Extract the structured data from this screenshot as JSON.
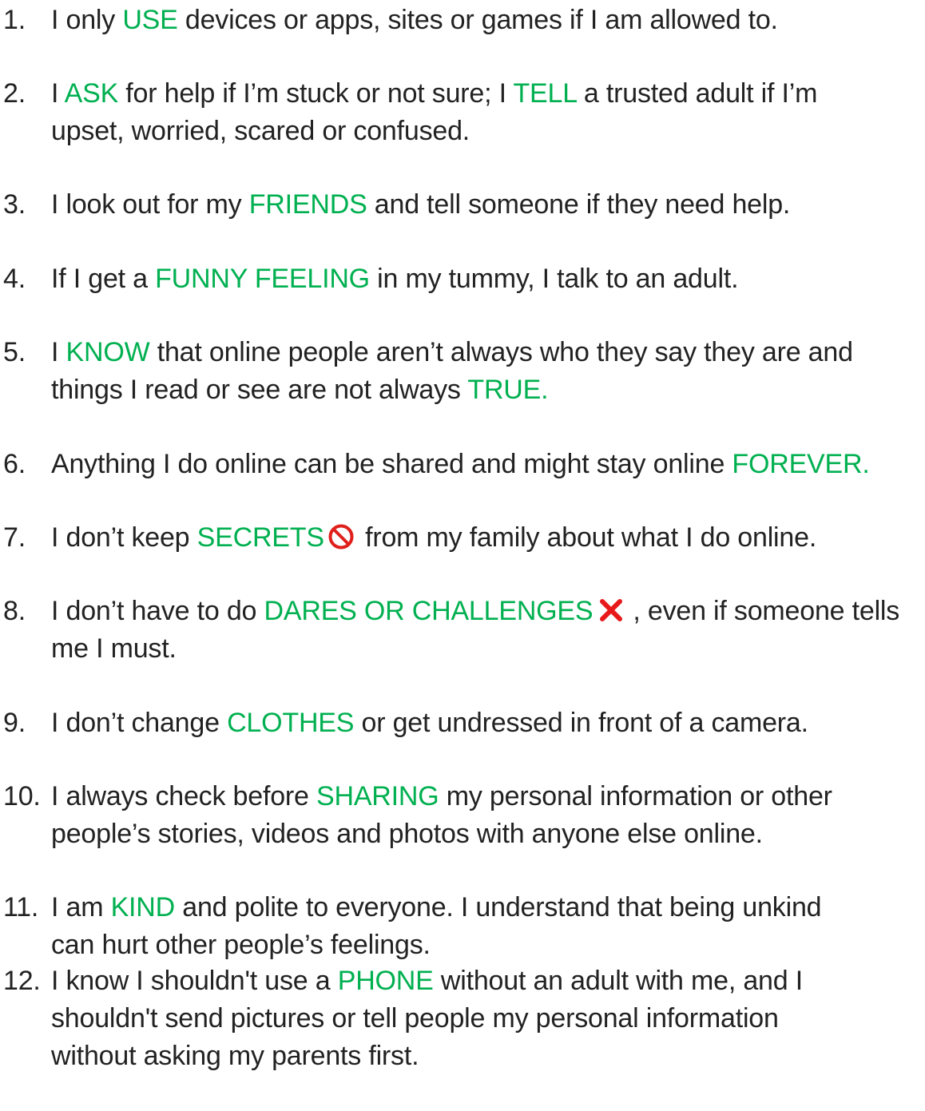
{
  "rules": [
    {
      "number": "1.",
      "lines": [
        [
          {
            "t": "I only "
          },
          {
            "t": "USE",
            "hl": true
          },
          {
            "t": " devices or apps, sites or games if I am allowed to."
          }
        ]
      ]
    },
    {
      "number": "2.",
      "lines": [
        [
          {
            "t": "I "
          },
          {
            "t": "ASK",
            "hl": true
          },
          {
            "t": " for help if I’m stuck or not sure; I "
          },
          {
            "t": "TELL",
            "hl": true
          },
          {
            "t": " a trusted adult if I’m"
          }
        ],
        [
          {
            "t": "upset, worried, scared or confused."
          }
        ]
      ]
    },
    {
      "number": "3.",
      "lines": [
        [
          {
            "t": "I look out for my "
          },
          {
            "t": "FRIENDS",
            "hl": true
          },
          {
            "t": " and tell someone if they need help."
          }
        ]
      ]
    },
    {
      "number": "4.",
      "lines": [
        [
          {
            "t": "If I get a "
          },
          {
            "t": "FUNNY FEELING",
            "hl": true
          },
          {
            "t": " in my tummy, I talk to an adult."
          }
        ]
      ]
    },
    {
      "number": "5.",
      "lines": [
        [
          {
            "t": "I "
          },
          {
            "t": "KNOW",
            "hl": true
          },
          {
            "t": " that online people aren’t always who they say they are and"
          }
        ],
        [
          {
            "t": "things I read or see are not always "
          },
          {
            "t": "TRUE.",
            "hl": true
          }
        ]
      ]
    },
    {
      "number": "6.",
      "lines": [
        [
          {
            "t": "Anything I do online can be shared and might stay online "
          },
          {
            "t": "FOREVER.",
            "hl": true
          }
        ]
      ]
    },
    {
      "number": "7.",
      "lines": [
        [
          {
            "t": "I don’t keep "
          },
          {
            "t": "SECRETS",
            "hl": true
          },
          {
            "icon": "prohibited-icon"
          },
          {
            "t": " from my family about what I do online."
          }
        ]
      ]
    },
    {
      "number": "8.",
      "lines": [
        [
          {
            "t": "I don’t have to do "
          },
          {
            "t": "DARES OR CHALLENGES",
            "hl": true
          },
          {
            "icon": "cross-mark-icon"
          },
          {
            "t": ", even if someone tells"
          }
        ],
        [
          {
            "t": "me I must."
          }
        ]
      ]
    },
    {
      "number": "9.",
      "lines": [
        [
          {
            "t": "I don’t change "
          },
          {
            "t": "CLOTHES",
            "hl": true
          },
          {
            "t": " or get undressed in front of a camera."
          }
        ]
      ]
    },
    {
      "number": "10.",
      "lines": [
        [
          {
            "t": "I always check before "
          },
          {
            "t": "SHARING",
            "hl": true
          },
          {
            "t": " my personal information or other"
          }
        ],
        [
          {
            "t": "people’s stories, videos and photos with anyone else online."
          }
        ]
      ]
    },
    {
      "number": "11.",
      "lines": [
        [
          {
            "t": "I am "
          },
          {
            "t": "KIND",
            "hl": true
          },
          {
            "t": " and polite to everyone. I understand that being unkind"
          }
        ],
        [
          {
            "t": "can hurt other people’s feelings."
          }
        ]
      ]
    },
    {
      "number": "12.",
      "lines": [
        [
          {
            "t": "I know I shouldn't use a "
          },
          {
            "t": "PHONE",
            "hl": true
          },
          {
            "t": " without an adult with me, and I"
          }
        ],
        [
          {
            "t": "shouldn't send pictures or tell people my personal information"
          }
        ],
        [
          {
            "t": "without asking my parents first."
          }
        ]
      ]
    }
  ],
  "colors": {
    "highlight": "#00B050",
    "text": "#222222",
    "prohibited_icon": "#E0201B",
    "cross_icon": "#E8191A"
  }
}
